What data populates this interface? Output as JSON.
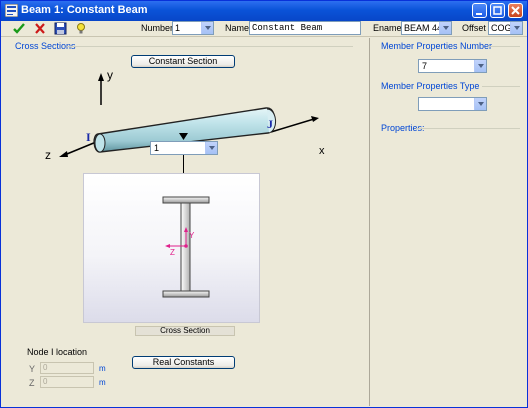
{
  "window": {
    "title": "Beam 1: Constant Beam"
  },
  "toolbar": {
    "number_label": "Number",
    "number_value": "1",
    "name_label": "Name",
    "name_value": "Constant Beam",
    "ename_label": "Ename",
    "ename_value": "BEAM 44",
    "offset_label": "Offset",
    "offset_value": "COG"
  },
  "cross_sections": {
    "group_label": "Cross Sections",
    "constant_section_button": "Constant Section",
    "section_select_value": "1",
    "cross_section_caption": "Cross Section",
    "real_constants_button": "Real Constants"
  },
  "beam_diagram": {
    "axis_y": "y",
    "axis_z": "z",
    "axis_x": "x",
    "node_i": "I",
    "node_j": "J"
  },
  "section_axes": {
    "y": "Y",
    "z": "Z"
  },
  "node_location": {
    "title": "Node I location",
    "y_label": "Y",
    "y_value": "0",
    "z_label": "Z",
    "z_value": "0",
    "unit": "m"
  },
  "member_properties": {
    "number_label": "Member Properties Number",
    "number_value": "7",
    "type_label": "Member Properties Type",
    "type_value": "",
    "properties_label": "Properties:"
  },
  "colors": {
    "titlebar": "#0a53d8",
    "panel_background": "#ece9d8",
    "group_label": "#0046d5",
    "beam": "#a8d4dc",
    "section_axis": "#e0208c"
  }
}
